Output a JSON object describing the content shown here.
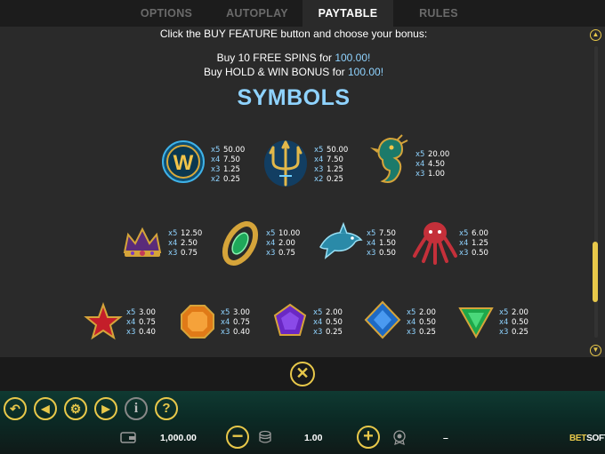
{
  "tabs": [
    {
      "label": "OPTIONS"
    },
    {
      "label": "AUTOPLAY"
    },
    {
      "label": "PAYTABLE"
    },
    {
      "label": "RULES"
    }
  ],
  "intro": {
    "line1": "Click the BUY FEATURE button and choose your bonus:",
    "line2_prefix": "Buy 10 FREE SPINS for ",
    "line2_value": "100.00!",
    "line3_prefix": "Buy HOLD & WIN BONUS for ",
    "line3_value": "100.00!"
  },
  "symbols_title": "SYMBOLS",
  "symbols": [
    {
      "icon": "wild-w-icon",
      "pays": [
        [
          "x5",
          "50.00"
        ],
        [
          "x4",
          "7.50"
        ],
        [
          "x3",
          "1.25"
        ],
        [
          "x2",
          "0.25"
        ]
      ]
    },
    {
      "icon": "trident-icon",
      "pays": [
        [
          "x5",
          "50.00"
        ],
        [
          "x4",
          "7.50"
        ],
        [
          "x3",
          "1.25"
        ],
        [
          "x2",
          "0.25"
        ]
      ]
    },
    {
      "icon": "seahorse-icon",
      "pays": [
        [
          "x5",
          "20.00"
        ],
        [
          "x4",
          "4.50"
        ],
        [
          "x3",
          "1.00"
        ]
      ]
    },
    {
      "icon": "crown-icon",
      "pays": [
        [
          "x5",
          "12.50"
        ],
        [
          "x4",
          "2.50"
        ],
        [
          "x3",
          "0.75"
        ]
      ]
    },
    {
      "icon": "emerald-bracelet-icon",
      "pays": [
        [
          "x5",
          "10.00"
        ],
        [
          "x4",
          "2.00"
        ],
        [
          "x3",
          "0.75"
        ]
      ]
    },
    {
      "icon": "dolphin-icon",
      "pays": [
        [
          "x5",
          "7.50"
        ],
        [
          "x4",
          "1.50"
        ],
        [
          "x3",
          "0.50"
        ]
      ]
    },
    {
      "icon": "octopus-icon",
      "pays": [
        [
          "x5",
          "6.00"
        ],
        [
          "x4",
          "1.25"
        ],
        [
          "x3",
          "0.50"
        ]
      ]
    },
    {
      "icon": "red-star-gem-icon",
      "pays": [
        [
          "x5",
          "3.00"
        ],
        [
          "x4",
          "0.75"
        ],
        [
          "x3",
          "0.40"
        ]
      ]
    },
    {
      "icon": "orange-octagon-gem-icon",
      "pays": [
        [
          "x5",
          "3.00"
        ],
        [
          "x4",
          "0.75"
        ],
        [
          "x3",
          "0.40"
        ]
      ]
    },
    {
      "icon": "purple-pentagon-gem-icon",
      "pays": [
        [
          "x5",
          "2.00"
        ],
        [
          "x4",
          "0.50"
        ],
        [
          "x3",
          "0.25"
        ]
      ]
    },
    {
      "icon": "blue-diamond-gem-icon",
      "pays": [
        [
          "x5",
          "2.00"
        ],
        [
          "x4",
          "0.50"
        ],
        [
          "x3",
          "0.25"
        ]
      ]
    },
    {
      "icon": "green-triangle-gem-icon",
      "pays": [
        [
          "x5",
          "2.00"
        ],
        [
          "x4",
          "0.50"
        ],
        [
          "x3",
          "0.25"
        ]
      ]
    }
  ],
  "footer": {
    "balance": "1,000.00",
    "bet": "1.00",
    "win": "–",
    "brand_prefix": "BET",
    "brand_suffix": "SOFT"
  },
  "colors": {
    "accent": "#e8c84a",
    "highlight": "#8fd3ff",
    "panel": "#2a2a2a",
    "background": "#1a1a1a"
  }
}
